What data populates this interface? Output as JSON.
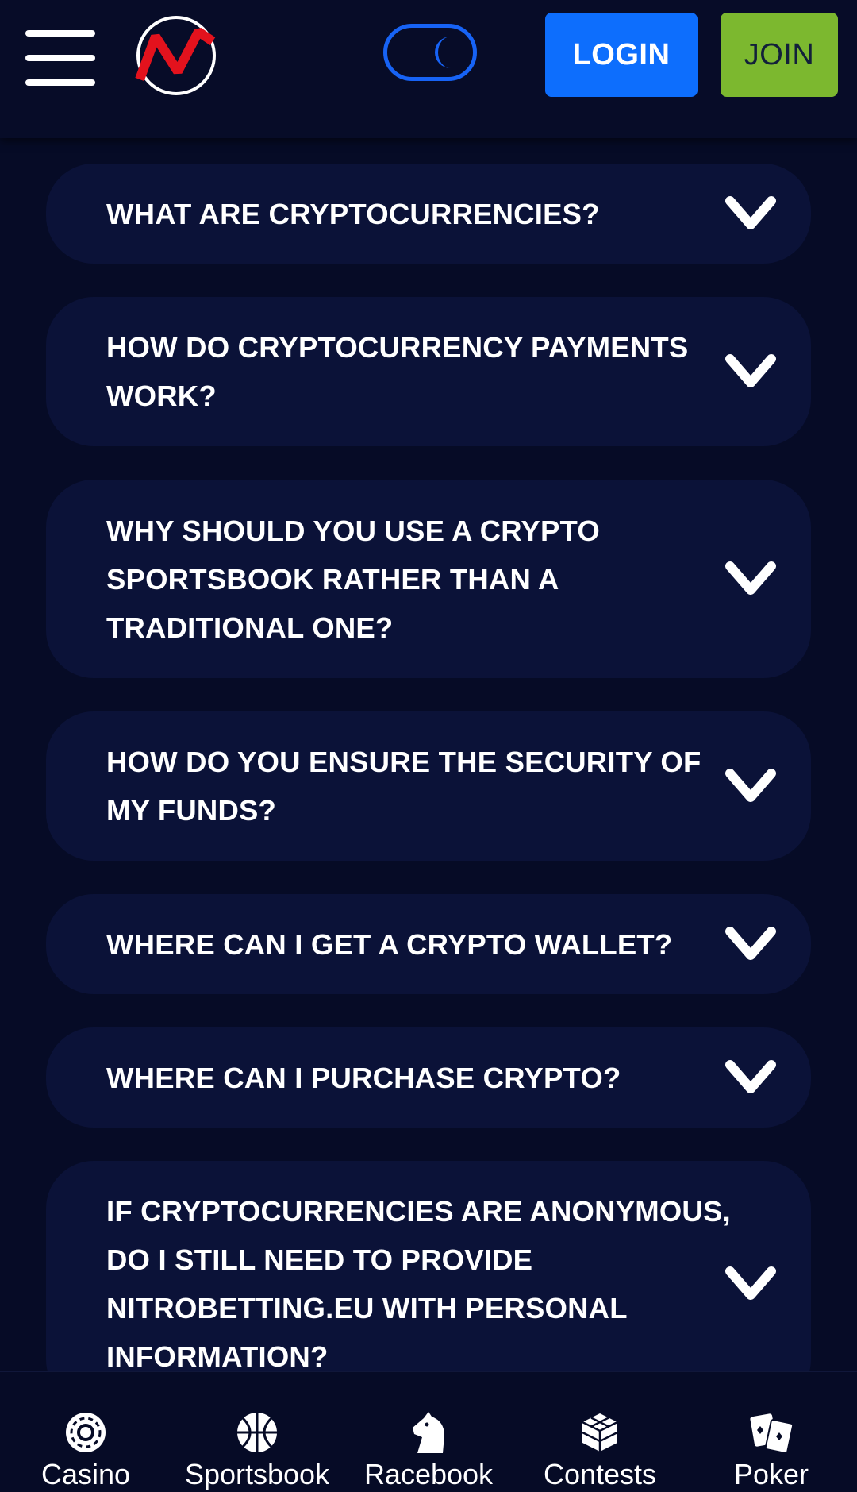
{
  "header": {
    "login_label": "LOGIN",
    "join_label": "JOIN",
    "logo_icon": "nitro-logo-icon",
    "theme_icon": "moon-icon"
  },
  "faq": {
    "items": [
      {
        "question": "WHAT ARE CRYPTOCURRENCIES?"
      },
      {
        "question": "HOW DO CRYPTOCURRENCY PAYMENTS WORK?"
      },
      {
        "question": "WHY SHOULD YOU USE A CRYPTO SPORTSBOOK RATHER THAN A TRADITIONAL ONE?"
      },
      {
        "question": "HOW DO YOU ENSURE THE SECURITY OF MY FUNDS?"
      },
      {
        "question": "WHERE CAN I GET A CRYPTO WALLET?"
      },
      {
        "question": "WHERE CAN I PURCHASE CRYPTO?"
      },
      {
        "question": "IF CRYPTOCURRENCIES ARE ANONYMOUS, DO I STILL NEED TO PROVIDE NITROBETTING.EU WITH PERSONAL INFORMATION?"
      }
    ]
  },
  "bottom_nav": {
    "items": [
      {
        "label": "Casino",
        "icon": "casino-chip-icon"
      },
      {
        "label": "Sportsbook",
        "icon": "basketball-icon"
      },
      {
        "label": "Racebook",
        "icon": "horse-head-icon"
      },
      {
        "label": "Contests",
        "icon": "cube-icon"
      },
      {
        "label": "Poker",
        "icon": "playing-cards-icon"
      }
    ]
  },
  "colors": {
    "background": "#060b26",
    "card": "#0b1238",
    "login": "#0d6efd",
    "join": "#7cb82f",
    "logo_red": "#e3121d"
  }
}
